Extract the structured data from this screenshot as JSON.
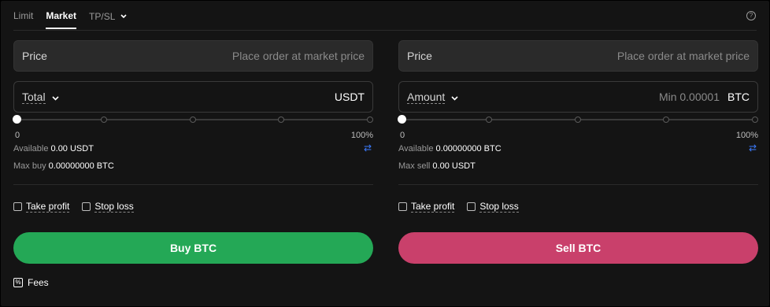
{
  "tabs": [
    {
      "label": "Limit"
    },
    {
      "label": "Market"
    },
    {
      "label": "TP/SL"
    }
  ],
  "help_glyph": "?",
  "buy": {
    "price_label": "Price",
    "price_placeholder": "Place order at market price",
    "amount_label": "Total",
    "amount_placeholder": "",
    "amount_unit": "USDT",
    "slider_min": "0",
    "slider_max": "100%",
    "slider_percent": 0,
    "available_label": "Available",
    "available_value": "0.00 USDT",
    "max_label": "Max buy",
    "max_value": "0.00000000 BTC",
    "take_profit": "Take profit",
    "stop_loss": "Stop loss",
    "action_label": "Buy BTC"
  },
  "sell": {
    "price_label": "Price",
    "price_placeholder": "Place order at market price",
    "amount_label": "Amount",
    "amount_placeholder": "Min 0.00001",
    "amount_unit": "BTC",
    "slider_min": "0",
    "slider_max": "100%",
    "slider_percent": 0,
    "available_label": "Available",
    "available_value": "0.00000000 BTC",
    "max_label": "Max sell",
    "max_value": "0.00 USDT",
    "take_profit": "Take profit",
    "stop_loss": "Stop loss",
    "action_label": "Sell BTC"
  },
  "fees_label": "Fees",
  "colors": {
    "buy": "#24a856",
    "sell": "#c9406b",
    "accent": "#3b7bff"
  }
}
